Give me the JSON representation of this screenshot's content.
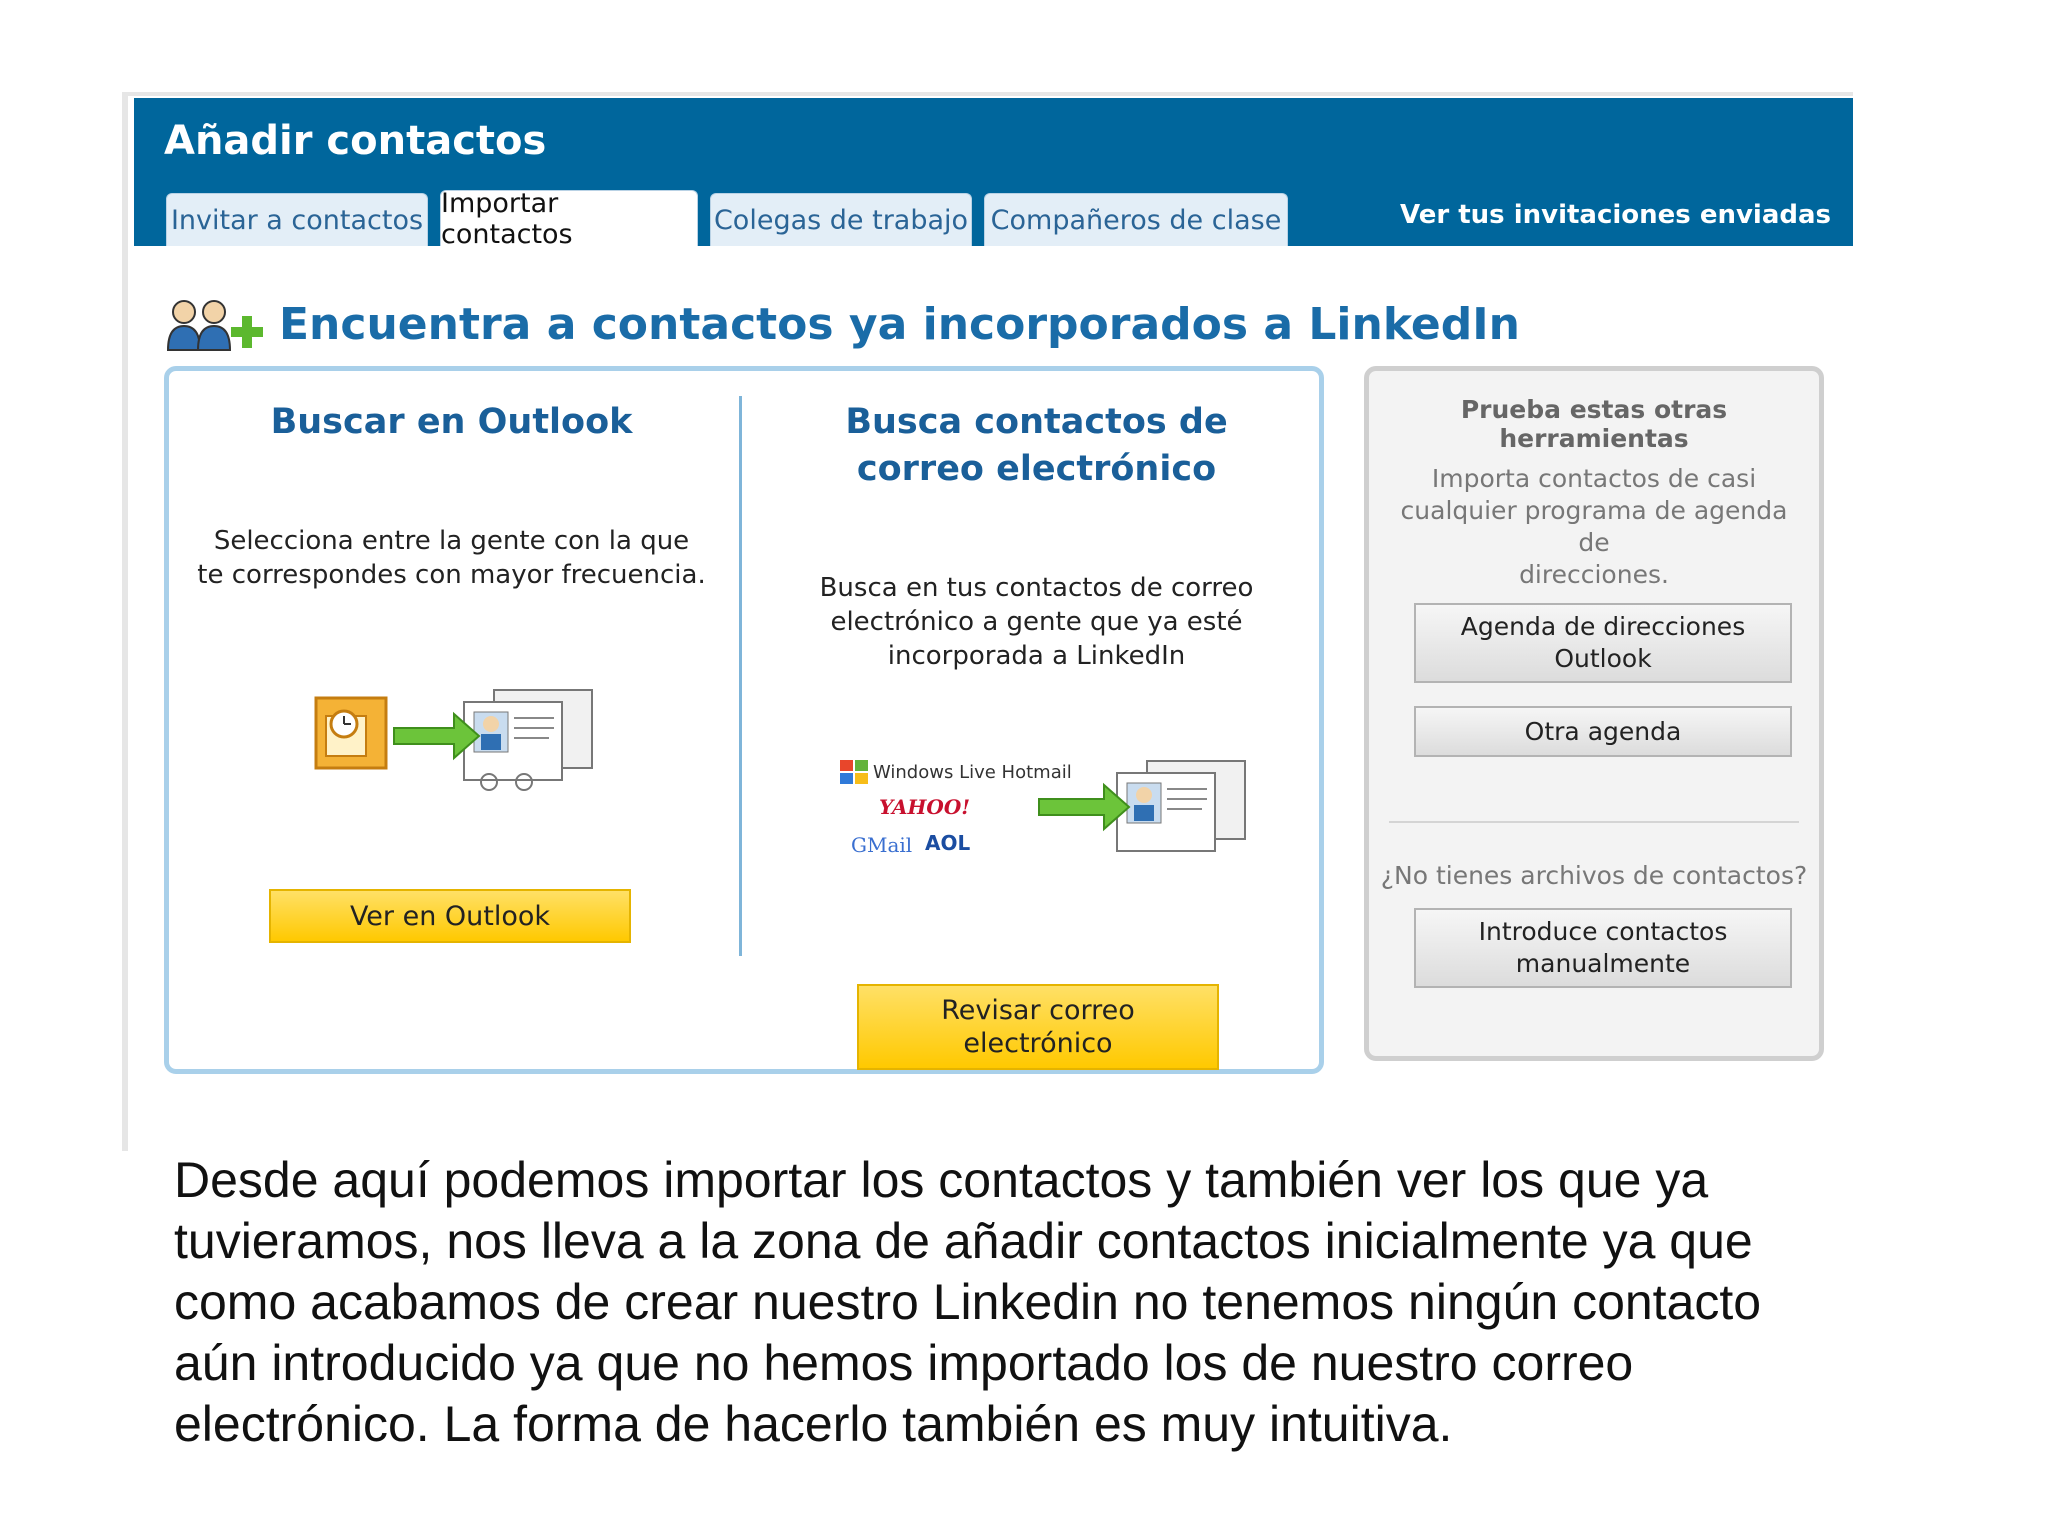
{
  "header": {
    "title": "Añadir contactos",
    "tabs": [
      {
        "label": "Invitar a contactos",
        "active": false
      },
      {
        "label": "Importar contactos",
        "active": true
      },
      {
        "label": "Colegas de trabajo",
        "active": false
      },
      {
        "label": "Compañeros de clase",
        "active": false
      }
    ],
    "invitations_link": "Ver tus invitaciones enviadas"
  },
  "heading": "Encuentra a contactos ya incorporados a LinkedIn",
  "outlook": {
    "title": "Buscar en Outlook",
    "description_line1": "Selecciona entre la gente con la que",
    "description_line2": "te correspondes con mayor frecuencia.",
    "button": "Ver en Outlook"
  },
  "email": {
    "title_line1": "Busca contactos de",
    "title_line2": "correo electrónico",
    "description_line1": "Busca en tus contactos de correo",
    "description_line2": "electrónico a gente que ya esté",
    "description_line3": "incorporada a LinkedIn",
    "logos": {
      "hotmail": "Windows Live Hotmail",
      "yahoo": "YAHOO!",
      "gmail": "GMail",
      "aol": "AOL"
    },
    "button_line1": "Revisar correo",
    "button_line2": "electrónico"
  },
  "side": {
    "title": "Prueba estas otras herramientas",
    "description_line1": "Importa contactos de casi",
    "description_line2": "cualquier programa de agenda de",
    "description_line3": "direcciones.",
    "btn_outlook_line1": "Agenda de direcciones",
    "btn_outlook_line2": "Outlook",
    "btn_other": "Otra agenda",
    "no_files": "¿No tienes archivos de contactos?",
    "btn_manual_line1": "Introduce contactos",
    "btn_manual_line2": "manualmente"
  },
  "caption_lines": [
    "Desde aquí podemos importar los contactos y también ver los que ya",
    "tuvieramos, nos lleva a la zona de añadir contactos inicialmente ya que",
    "como acabamos de crear nuestro Linkedin no tenemos ningún contacto",
    "aún introducido ya que no hemos importado los de nuestro correo",
    "electrónico. La forma de hacerlo también es muy intuitiva."
  ],
  "colors": {
    "header_blue": "#00669c",
    "accent_yellow": "#ffc900",
    "heading_blue": "#1a6ca8"
  }
}
